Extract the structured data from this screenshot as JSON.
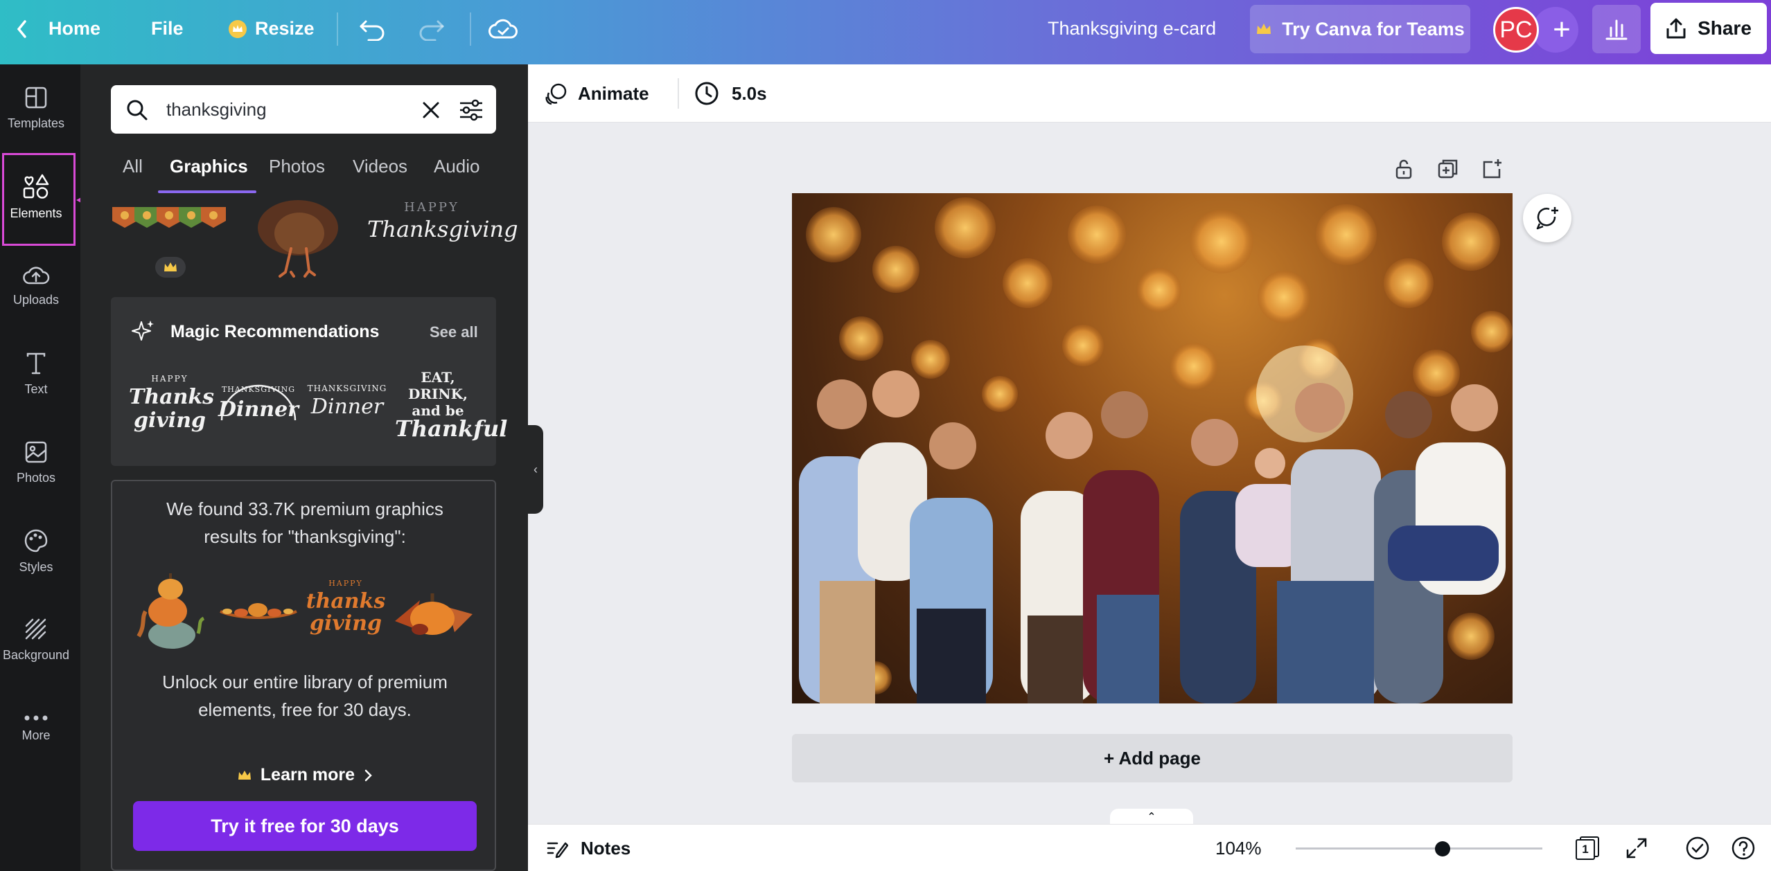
{
  "topbar": {
    "home": "Home",
    "file": "File",
    "resize": "Resize",
    "doc_title": "Thanksgiving e-card",
    "teams": "Try Canva for Teams",
    "avatar_initials": "PC",
    "share": "Share"
  },
  "rail": {
    "items": [
      {
        "label": "Templates",
        "icon": "templates-icon"
      },
      {
        "label": "Elements",
        "icon": "elements-icon"
      },
      {
        "label": "Uploads",
        "icon": "uploads-icon"
      },
      {
        "label": "Text",
        "icon": "text-icon"
      },
      {
        "label": "Photos",
        "icon": "photos-icon"
      },
      {
        "label": "Styles",
        "icon": "styles-icon"
      },
      {
        "label": "Background",
        "icon": "background-icon"
      },
      {
        "label": "More",
        "icon": "more-icon"
      }
    ]
  },
  "panel": {
    "search_value": "thanksgiving",
    "tabs": [
      "All",
      "Graphics",
      "Photos",
      "Videos",
      "Audio"
    ],
    "active_tab": "Graphics",
    "top_graphic_text": {
      "small": "HAPPY",
      "big": "Thanksgiving"
    },
    "magic": {
      "title": "Magic Recommendations",
      "see_all": "See all",
      "items": [
        {
          "small": "HAPPY",
          "big": "Thanks giving"
        },
        {
          "small": "THANKSGIVING",
          "big": "Dinner"
        },
        {
          "small": "THANKSGIVING",
          "big": "Dinner"
        },
        {
          "small": "EAT, DRINK, and be",
          "big": "Thankful"
        }
      ]
    },
    "premium": {
      "line1": "We found 33.7K premium graphics",
      "line2": "results for \"thanksgiving\":",
      "unlock1": "Unlock our entire library of premium",
      "unlock2": "elements, free for 30 days.",
      "learn_more": "Learn more",
      "try_btn": "Try it free for 30 days",
      "sample_script": {
        "small": "HAPPY",
        "big": "thanks giving"
      }
    }
  },
  "editor": {
    "animate": "Animate",
    "duration": "5.0s",
    "add_page": "+ Add page",
    "notes": "Notes",
    "zoom": "104%",
    "zoom_level_percent": 104,
    "page_count": "1"
  },
  "colors": {
    "accent_purple": "#7d2ae8",
    "avatar_red": "#e53949",
    "highlight_magenta": "#d94ad7"
  }
}
